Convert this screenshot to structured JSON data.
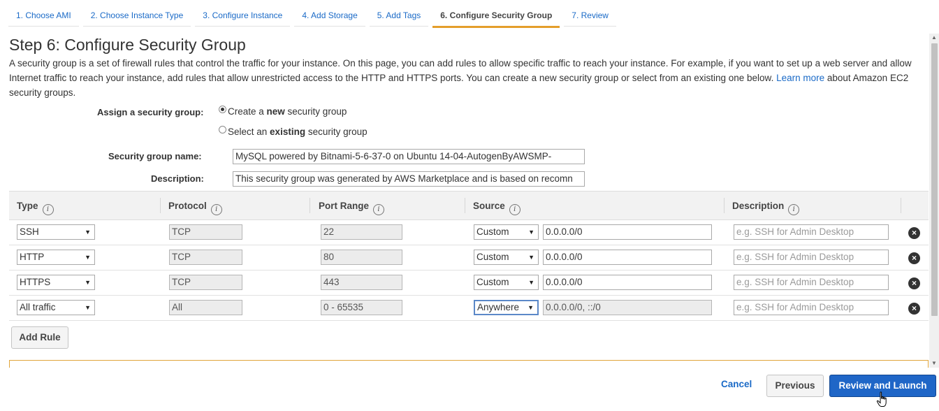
{
  "steps": [
    {
      "label": "1. Choose AMI"
    },
    {
      "label": "2. Choose Instance Type"
    },
    {
      "label": "3. Configure Instance"
    },
    {
      "label": "4. Add Storage"
    },
    {
      "label": "5. Add Tags"
    },
    {
      "label": "6. Configure Security Group"
    },
    {
      "label": "7. Review"
    }
  ],
  "active_step": 5,
  "page": {
    "title": "Step 6: Configure Security Group",
    "intro_text": "A security group is a set of firewall rules that control the traffic for your instance. On this page, you can add rules to allow specific traffic to reach your instance. For example, if you want to set up a web server and allow Internet traffic to reach your instance, add rules that allow unrestricted access to the HTTP and HTTPS ports. You can create a new security group or select from an existing one below. ",
    "learn_more": "Learn more",
    "intro_tail": " about Amazon EC2 security groups."
  },
  "assign": {
    "label": "Assign a security group:",
    "option_new_pre": "Create a ",
    "option_new_bold": "new",
    "option_new_post": " security group",
    "option_existing_pre": "Select an ",
    "option_existing_bold": "existing",
    "option_existing_post": " security group",
    "selected": "new"
  },
  "group_name": {
    "label": "Security group name:",
    "value": "MySQL powered by Bitnami-5-6-37-0 on Ubuntu 14-04-AutogenByAWSMP-"
  },
  "group_description": {
    "label": "Description:",
    "value": "This security group was generated by AWS Marketplace and is based on recomn"
  },
  "table": {
    "headers": {
      "type": "Type",
      "protocol": "Protocol",
      "port_range": "Port Range",
      "source": "Source",
      "description": "Description"
    },
    "info_glyph": "i",
    "description_placeholder": "e.g. SSH for Admin Desktop",
    "rows": [
      {
        "type": "SSH",
        "protocol": "TCP",
        "port": "22",
        "source_type": "Custom",
        "source": "0.0.0.0/0"
      },
      {
        "type": "HTTP",
        "protocol": "TCP",
        "port": "80",
        "source_type": "Custom",
        "source": "0.0.0.0/0"
      },
      {
        "type": "HTTPS",
        "protocol": "TCP",
        "port": "443",
        "source_type": "Custom",
        "source": "0.0.0.0/0"
      },
      {
        "type": "All traffic",
        "protocol": "All",
        "port": "0 - 65535",
        "source_type": "Anywhere",
        "source": "0.0.0.0/0, ::/0"
      }
    ]
  },
  "add_rule_label": "Add Rule",
  "footer": {
    "cancel": "Cancel",
    "previous": "Previous",
    "review_launch": "Review and Launch"
  },
  "icons": {
    "dropdown": "▼",
    "delete": "×",
    "scroll_up": "▲",
    "scroll_down": "▼"
  },
  "colors": {
    "link": "#1a6ac7",
    "active_step_underline": "#e49e2b",
    "primary_button": "#1f66c7"
  }
}
